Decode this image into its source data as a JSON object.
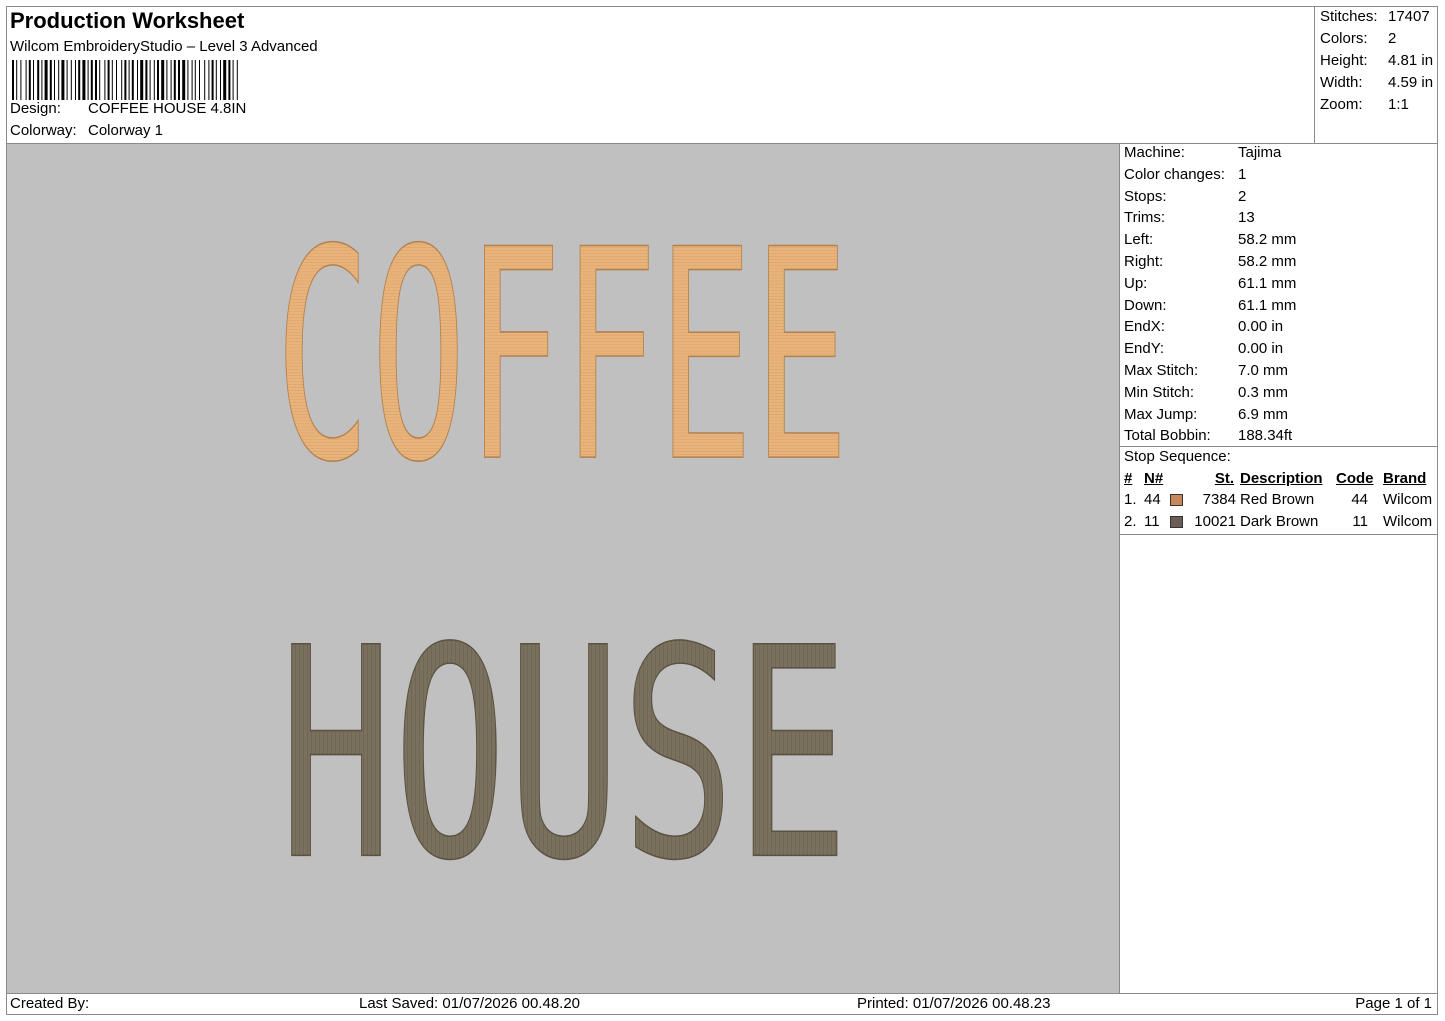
{
  "header": {
    "title": "Production Worksheet",
    "software": "Wilcom EmbroideryStudio – Level 3 Advanced",
    "design_label": "Design:",
    "design_value": "COFFEE HOUSE 4.8IN",
    "colorway_label": "Colorway:",
    "colorway_value": "Colorway 1"
  },
  "stats": [
    {
      "label": "Stitches:",
      "value": "17407"
    },
    {
      "label": "Colors:",
      "value": "2"
    },
    {
      "label": "Height:",
      "value": "4.81 in"
    },
    {
      "label": "Width:",
      "value": "4.59 in"
    },
    {
      "label": "Zoom:",
      "value": "1:1"
    }
  ],
  "design_preview": {
    "line1": "COFFEE",
    "line2": "HOUSE",
    "line1_color": "#e8b47c",
    "line2_color": "#7a705e",
    "background": "#c0c0c0"
  },
  "details": [
    {
      "label": "Machine:",
      "value": "Tajima"
    },
    {
      "label": "Color changes:",
      "value": "1"
    },
    {
      "label": "Stops:",
      "value": "2"
    },
    {
      "label": "Trims:",
      "value": "13"
    },
    {
      "label": "Left:",
      "value": "58.2 mm"
    },
    {
      "label": "Right:",
      "value": "58.2 mm"
    },
    {
      "label": "Up:",
      "value": "61.1 mm"
    },
    {
      "label": "Down:",
      "value": "61.1 mm"
    },
    {
      "label": "EndX:",
      "value": "0.00 in"
    },
    {
      "label": "EndY:",
      "value": "0.00 in"
    },
    {
      "label": "Max Stitch:",
      "value": "7.0 mm"
    },
    {
      "label": "Min Stitch:",
      "value": "0.3 mm"
    },
    {
      "label": "Max Jump:",
      "value": "6.9 mm"
    },
    {
      "label": "Total Bobbin:",
      "value": "188.34ft"
    }
  ],
  "stop_sequence": {
    "title": "Stop Sequence:",
    "columns": {
      "index": "#",
      "needle": "N#",
      "stitches": "St.",
      "description": "Description",
      "code": "Code",
      "brand": "Brand"
    },
    "rows": [
      {
        "index": "1.",
        "needle": "44",
        "swatch": "#c8875a",
        "stitches": "7384",
        "description": "Red Brown",
        "code": "44",
        "brand": "Wilcom"
      },
      {
        "index": "2.",
        "needle": "11",
        "swatch": "#6b5d55",
        "stitches": "10021",
        "description": "Dark Brown",
        "code": "11",
        "brand": "Wilcom"
      }
    ]
  },
  "footer": {
    "created_by": "Created By:",
    "last_saved": "Last Saved: 01/07/2026 00.48.20",
    "printed": "Printed: 01/07/2026 00.48.23",
    "page": "Page 1 of 1"
  }
}
